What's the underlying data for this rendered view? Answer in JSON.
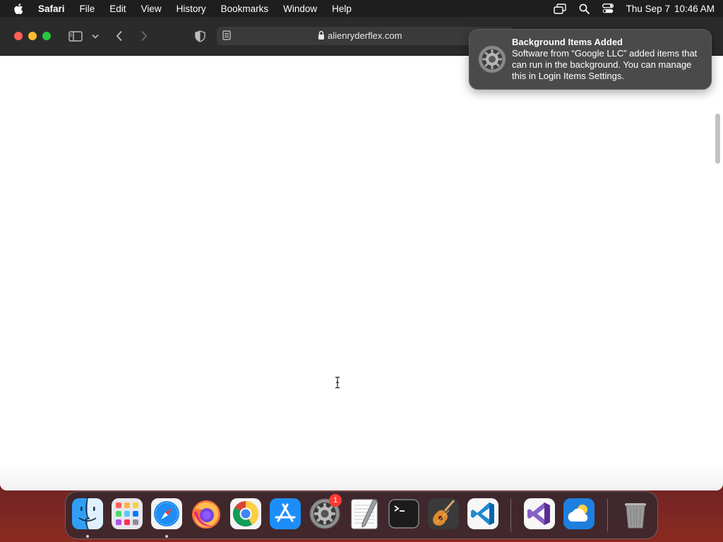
{
  "menubar": {
    "apple_icon": "apple-logo-icon",
    "app_name": "Safari",
    "items": [
      "File",
      "Edit",
      "View",
      "History",
      "Bookmarks",
      "Window",
      "Help"
    ],
    "status_icons": [
      "screen-mirroring-icon",
      "spotlight-search-icon",
      "control-center-icon"
    ],
    "clock": {
      "date": "Thu Sep 7",
      "time": "10:46 AM"
    }
  },
  "browser": {
    "address": {
      "url": "alienryderflex.com",
      "reader_icon": "reader-mode-icon",
      "lock_icon": "lock-icon"
    },
    "toolbar_icons": [
      "sidebar-toggle-icon",
      "chevron-down-icon",
      "back-arrow-icon",
      "forward-arrow-icon",
      "privacy-shield-icon"
    ]
  },
  "notification": {
    "title": "Background Items Added",
    "body": "Software from “Google LLC” added items that can run in the background. You can manage this in Login Items Settings.",
    "icon": "system-settings-gear-icon"
  },
  "dock": {
    "apps": [
      "Finder",
      "Launchpad",
      "Safari",
      "Firefox",
      "Google Chrome",
      "App Store",
      "System Settings",
      "TextEdit",
      "Terminal",
      "GarageBand",
      "Visual Studio Code",
      "Visual Studio",
      "Weather",
      "Trash"
    ],
    "system_settings_badge": "1",
    "running": [
      "Finder",
      "Safari"
    ]
  },
  "colors": {
    "traffic_close": "#fe5f57",
    "traffic_minimize": "#febc2e",
    "traffic_maximize": "#28c840",
    "badge": "#ff3b30"
  }
}
